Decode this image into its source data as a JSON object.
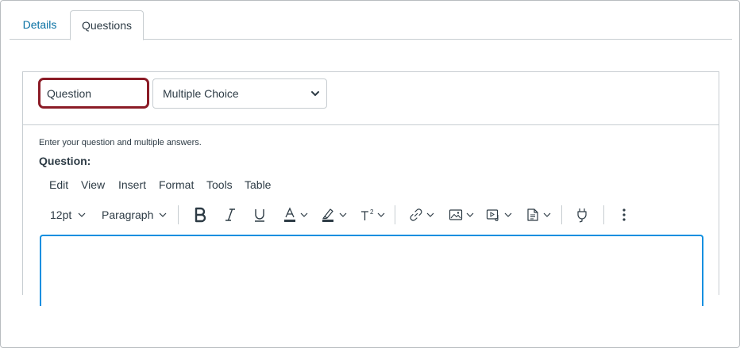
{
  "tabs": [
    {
      "label": "Details",
      "active": false
    },
    {
      "label": "Questions",
      "active": true
    }
  ],
  "question": {
    "name_value": "Question",
    "type_selected": "Multiple Choice",
    "instructions": "Enter your question and multiple answers.",
    "label": "Question:"
  },
  "editor": {
    "menubar": [
      "Edit",
      "View",
      "Insert",
      "Format",
      "Tools",
      "Table"
    ],
    "font_size": "12pt",
    "block_format": "Paragraph",
    "toolbar_icons": [
      "bold-icon",
      "italic-icon",
      "underline-icon",
      "text-color-icon",
      "highlight-color-icon",
      "superscript-icon",
      "link-icon",
      "image-icon",
      "media-icon",
      "document-icon",
      "plugin-icon",
      "more-icon"
    ]
  },
  "colors": {
    "link": "#0770a3",
    "focus_outline": "#8b1b26",
    "editor_focus": "#0b8fe0",
    "border": "#c7cdd1",
    "text": "#2d3b45"
  }
}
